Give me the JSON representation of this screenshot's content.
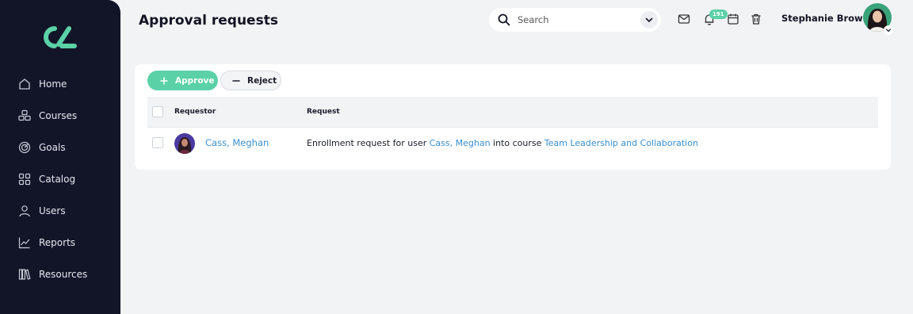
{
  "sidebar": {
    "items": [
      {
        "label": "Home",
        "icon": "home-icon"
      },
      {
        "label": "Courses",
        "icon": "courses-icon"
      },
      {
        "label": "Goals",
        "icon": "goals-icon"
      },
      {
        "label": "Catalog",
        "icon": "catalog-icon"
      },
      {
        "label": "Users",
        "icon": "users-icon"
      },
      {
        "label": "Reports",
        "icon": "reports-icon"
      },
      {
        "label": "Resources",
        "icon": "resources-icon"
      }
    ]
  },
  "header": {
    "title": "Approval requests",
    "search_placeholder": "Search",
    "notifications_count": "191",
    "user_name": "Stephanie Brown"
  },
  "toolbar": {
    "approve_label": "Approve",
    "reject_label": "Reject"
  },
  "table": {
    "columns": [
      "Requestor",
      "Request"
    ],
    "rows": [
      {
        "requestor": "Cass, Meghan",
        "request_prefix": "Enrollment request for user ",
        "request_user": "Cass, Meghan",
        "request_mid": " into course ",
        "request_course": "Team Leadership and Collaboration"
      }
    ]
  },
  "colors": {
    "sidebar_bg": "#121528",
    "accent": "#5bd1a7",
    "link": "#3b8fd0",
    "page_bg": "#f2f3f5"
  }
}
